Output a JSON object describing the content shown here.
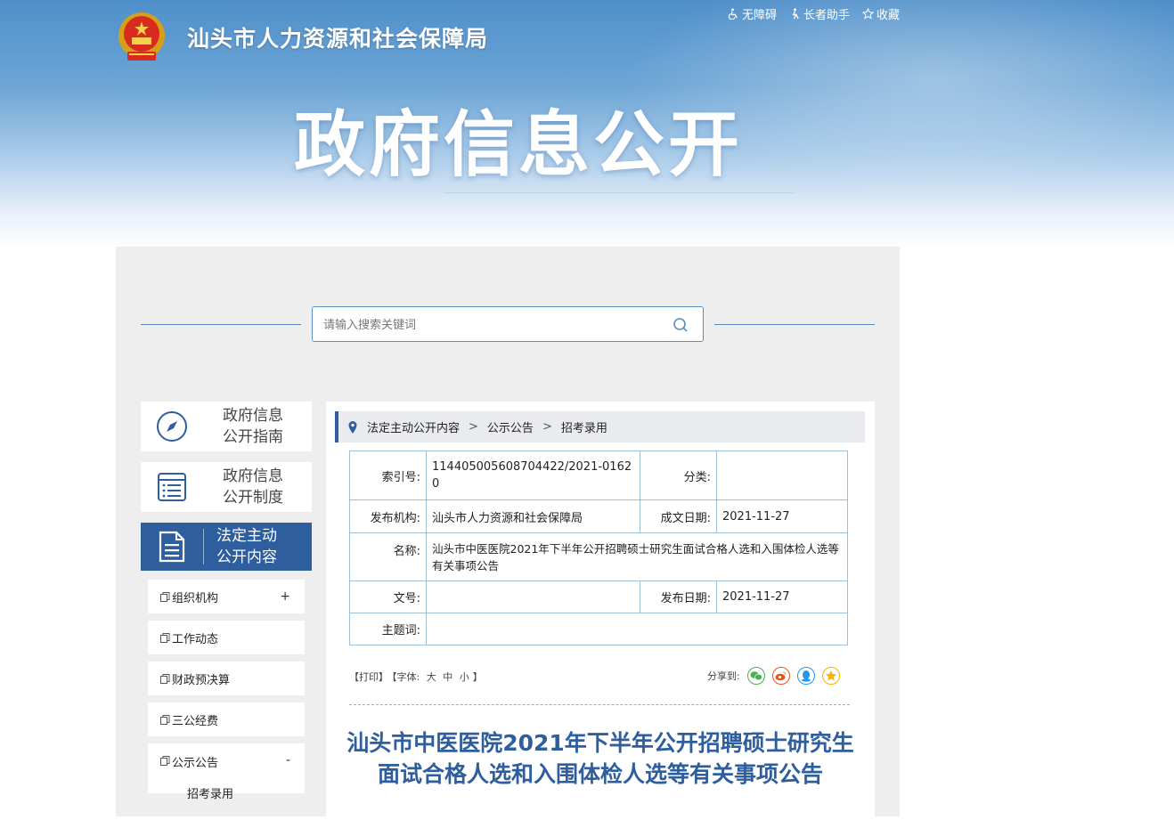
{
  "header": {
    "site_name": "汕头市人力资源和社会保障局",
    "links": [
      {
        "label": "无障碍",
        "icon": "wheelchair-icon"
      },
      {
        "label": "长者助手",
        "icon": "elder-icon"
      },
      {
        "label": "收藏",
        "icon": "star-icon"
      }
    ],
    "hero_title": "政府信息公开"
  },
  "search": {
    "placeholder": "请输入搜索关键词",
    "value": ""
  },
  "sidebar": {
    "items": [
      {
        "label_line1": "政府信息",
        "label_line2": "公开指南",
        "icon": "compass-icon",
        "active": false
      },
      {
        "label_line1": "政府信息",
        "label_line2": "公开制度",
        "icon": "list-icon",
        "active": false
      },
      {
        "label_line1": "法定主动",
        "label_line2": "公开内容",
        "icon": "document-icon",
        "active": true
      }
    ],
    "subitems": [
      {
        "label": "组织机构",
        "toggle": "+"
      },
      {
        "label": "工作动态",
        "toggle": ""
      },
      {
        "label": "财政预决算",
        "toggle": ""
      },
      {
        "label": "三公经费",
        "toggle": ""
      },
      {
        "label": "公示公告",
        "toggle": "-"
      },
      {
        "label": "招考录用",
        "toggle": ""
      }
    ]
  },
  "breadcrumb": [
    "法定主动公开内容",
    "公示公告",
    "招考录用"
  ],
  "meta": {
    "index_label": "索引号:",
    "index_value": "114405005608704422/2021-01620",
    "category_label": "分类:",
    "category_value": "",
    "publisher_label": "发布机构:",
    "publisher_value": "汕头市人力资源和社会保障局",
    "created_label": "成文日期:",
    "created_value": "2021-11-27",
    "name_label": "名称:",
    "name_value": "汕头市中医医院2021年下半年公开招聘硕士研究生面试合格人选和入围体检人选等有关事项公告",
    "docno_label": "文号:",
    "docno_value": "",
    "published_label": "发布日期:",
    "published_value": "2021-11-27",
    "subject_label": "主题词:",
    "subject_value": ""
  },
  "tools": {
    "print": "【打印】",
    "font_label": "【字体:",
    "large": "大",
    "medium": "中",
    "small": "小",
    "close": "】",
    "share_label": "分享到:"
  },
  "share": [
    {
      "icon": "wechat-icon",
      "color": "#4caf50"
    },
    {
      "icon": "weibo-icon",
      "color": "#e8541e"
    },
    {
      "icon": "qq-icon",
      "color": "#2196f3"
    },
    {
      "icon": "qzone-icon",
      "color": "#f5b400"
    }
  ],
  "article": {
    "title": "汕头市中医医院2021年下半年公开招聘硕士研究生面试合格人选和入围体检人选等有关事项公告"
  }
}
